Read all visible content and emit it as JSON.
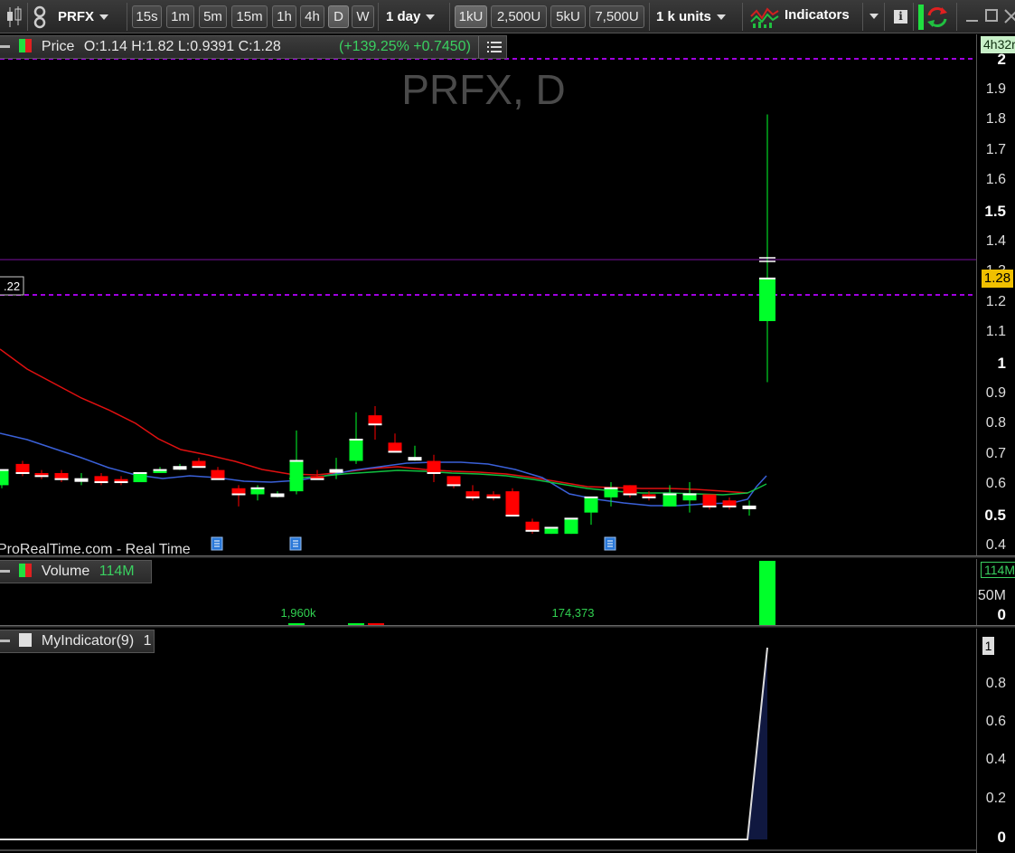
{
  "toolbar": {
    "symbol": "PRFX",
    "timeframes": [
      "15s",
      "1m",
      "5m",
      "15m",
      "1h",
      "4h",
      "D",
      "W"
    ],
    "active_timeframe": "D",
    "interval": "1 day",
    "tick_units": [
      "1kU",
      "2,500U",
      "5kU",
      "7,500U"
    ],
    "active_tick": "1kU",
    "units": "1 k units",
    "indicators_label": "Indicators",
    "info_label": "i"
  },
  "price_panel": {
    "label": "Price",
    "ohlc": "O:1.14 H:1.82 L:0.9391 C:1.28",
    "change": "(+139.25% +0.7450)",
    "watermark": "PRFX, D",
    "source": "ProRealTime.com - Real Time",
    "timer": "4h32r",
    "current_price": "1.28",
    "left_price_tag": ".22",
    "y_ticks": [
      {
        "v": "2",
        "bold": true
      },
      {
        "v": "1.9",
        "bold": false
      },
      {
        "v": "1.8",
        "bold": false
      },
      {
        "v": "1.7",
        "bold": false
      },
      {
        "v": "1.6",
        "bold": false
      },
      {
        "v": "1.5",
        "bold": true
      },
      {
        "v": "1.4",
        "bold": false
      },
      {
        "v": "1.3",
        "bold": false
      },
      {
        "v": "1.2",
        "bold": false
      },
      {
        "v": "1.1",
        "bold": false
      },
      {
        "v": "1",
        "bold": true
      },
      {
        "v": "0.9",
        "bold": false
      },
      {
        "v": "0.8",
        "bold": false
      },
      {
        "v": "0.7",
        "bold": false
      },
      {
        "v": "0.6",
        "bold": false
      },
      {
        "v": "0.5",
        "bold": true
      },
      {
        "v": "0.4",
        "bold": false
      }
    ],
    "colors": {
      "up": "#00ff2a",
      "down": "#ff0000",
      "ma_red": "#e01010",
      "ma_blue": "#3a60d8",
      "ma_green": "#10c040",
      "level": "#a000e0"
    }
  },
  "volume_panel": {
    "label": "Volume",
    "value": "114M",
    "annotations": [
      "1,960k",
      "174,373"
    ],
    "y_ticks": [
      "114M",
      "50M",
      "0"
    ]
  },
  "indicator_panel": {
    "label": "MyIndicator(9)",
    "value": "1",
    "y_ticks": [
      "1",
      "0.8",
      "0.6",
      "0.4",
      "0.2",
      "0"
    ]
  }
}
